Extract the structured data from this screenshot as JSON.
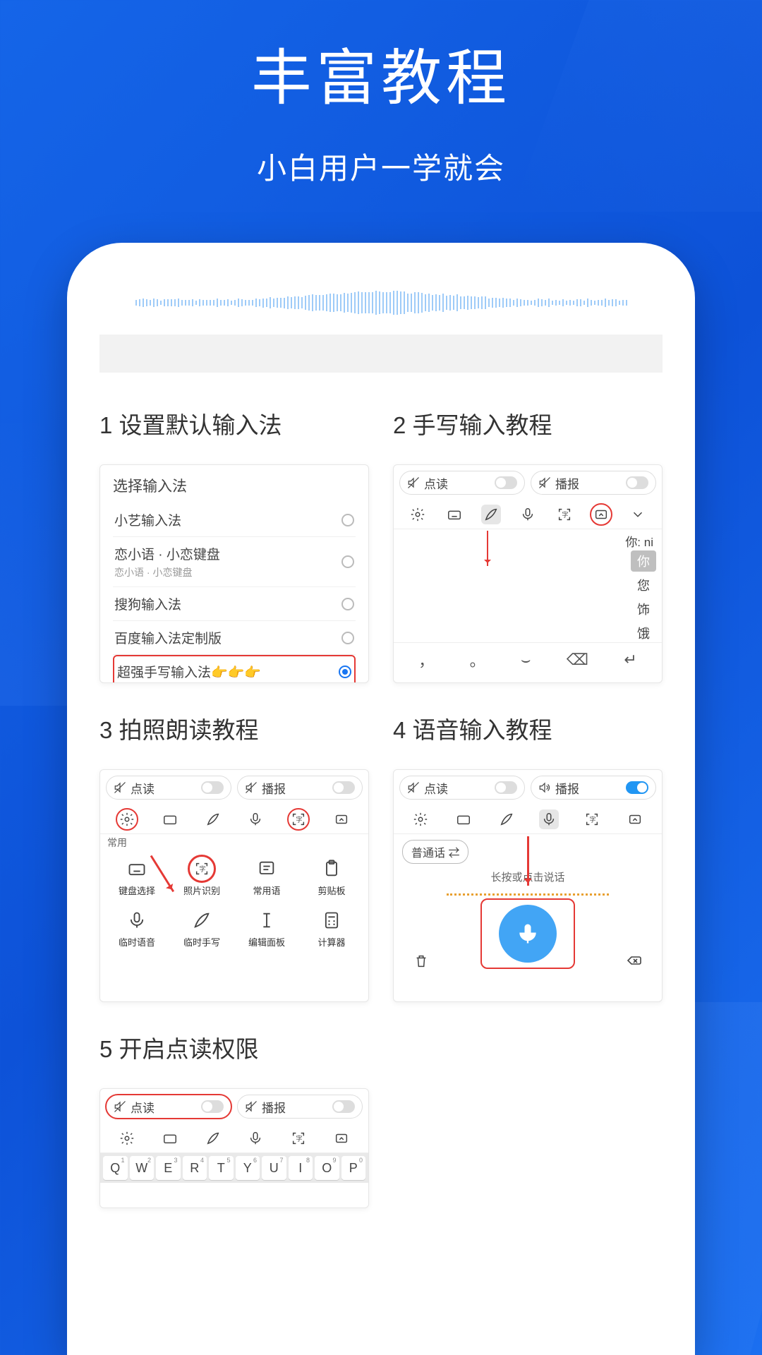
{
  "header": {
    "title": "丰富教程",
    "subtitle": "小白用户一学就会"
  },
  "items": [
    {
      "num": "1",
      "title": "设置默认输入法"
    },
    {
      "num": "2",
      "title": "手写输入教程"
    },
    {
      "num": "3",
      "title": "拍照朗读教程"
    },
    {
      "num": "4",
      "title": "语音输入教程"
    },
    {
      "num": "5",
      "title": "开启点读权限"
    }
  ],
  "toggles": {
    "read": "点读",
    "broadcast": "播报"
  },
  "thumb1": {
    "header": "选择输入法",
    "options": [
      {
        "label": "小艺输入法",
        "sub": ""
      },
      {
        "label": "恋小语 · 小恋键盘",
        "sub": "恋小语 · 小恋键盘"
      },
      {
        "label": "搜狗输入法",
        "sub": ""
      },
      {
        "label": "百度输入法定制版",
        "sub": ""
      },
      {
        "label": "超强手写输入法👉👉👉",
        "sub": "",
        "selected": true
      }
    ]
  },
  "thumb2": {
    "ni_label": "你: ni",
    "candidates": [
      "你",
      "您",
      "饰",
      "饿"
    ],
    "bottom": [
      "，",
      "。",
      "⌣",
      "⌫",
      "↵"
    ]
  },
  "thumb3": {
    "common_label": "常用",
    "row1": [
      {
        "label": "键盘选择",
        "icon": "keyboard"
      },
      {
        "label": "照片识别",
        "icon": "scan",
        "circled": true
      },
      {
        "label": "常用语",
        "icon": "phrases"
      },
      {
        "label": "剪贴板",
        "icon": "clipboard"
      }
    ],
    "row2": [
      {
        "label": "临时语音",
        "icon": "mic"
      },
      {
        "label": "临时手写",
        "icon": "feather"
      },
      {
        "label": "编辑面板",
        "icon": "cursor"
      },
      {
        "label": "计算器",
        "icon": "calc"
      }
    ]
  },
  "thumb4": {
    "lang_pill": "普通话 ⇄",
    "hint": "长按或点击说话"
  },
  "thumb5": {
    "keys": [
      "Q",
      "W",
      "E",
      "R",
      "T",
      "Y",
      "U",
      "I",
      "O",
      "P"
    ],
    "nums": [
      "1",
      "2",
      "3",
      "4",
      "5",
      "6",
      "7",
      "8",
      "9",
      "0"
    ]
  }
}
